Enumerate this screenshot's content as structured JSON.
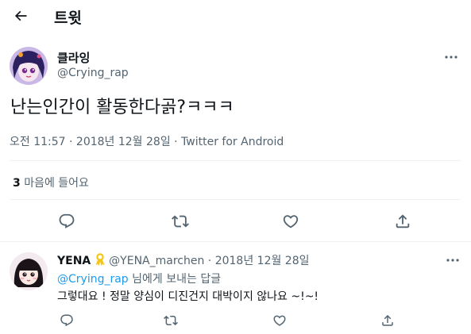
{
  "header": {
    "title": "트윗",
    "back_icon": "arrow-left-icon"
  },
  "tweet": {
    "author_name": "클라잉",
    "author_handle": "@Crying_rap",
    "text": "난는인간이 활동한다곩?ㅋㅋㅋ",
    "meta": "오전 11:57 · 2018년 12월 28일 · Twitter for Android",
    "likes_count": "3",
    "likes_label": "마음에 들어요"
  },
  "actions": [
    "reply-icon",
    "retweet-icon",
    "heart-icon",
    "share-icon"
  ],
  "reply": {
    "name": "YENA",
    "badge_icon": "ribbon-icon",
    "handle": "@YENA_marchen",
    "dot": "·",
    "date": "2018년 12월 28일",
    "mention": "@Crying_rap",
    "replying_suffix": " 님에게 보내는 답글",
    "text": "그렇대요 ! 정말 양심이 디진건지 대박이지 않나요 ~!~!"
  },
  "colors": {
    "accent": "#1d9bf0",
    "secondary_text": "#536471",
    "divider": "#eff3f4",
    "ribbon": "#f5c518"
  }
}
